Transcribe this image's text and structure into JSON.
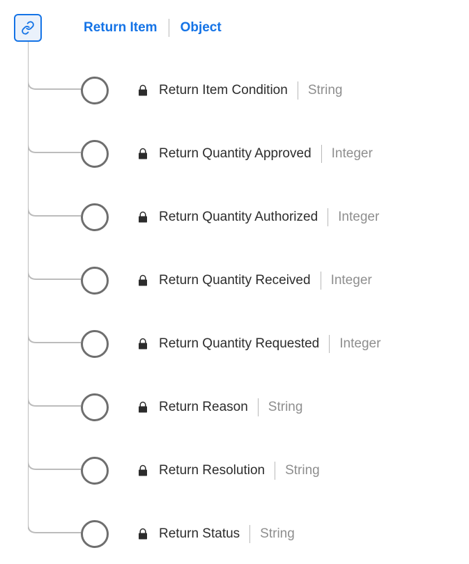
{
  "root": {
    "name": "Return Item",
    "type": "Object"
  },
  "children": [
    {
      "name": "Return Item Condition",
      "type": "String",
      "locked": true
    },
    {
      "name": "Return Quantity Approved",
      "type": "Integer",
      "locked": true
    },
    {
      "name": "Return Quantity Authorized",
      "type": "Integer",
      "locked": true
    },
    {
      "name": "Return Quantity Received",
      "type": "Integer",
      "locked": true
    },
    {
      "name": "Return Quantity Requested",
      "type": "Integer",
      "locked": true
    },
    {
      "name": "Return Reason",
      "type": "String",
      "locked": true
    },
    {
      "name": "Return Resolution",
      "type": "String",
      "locked": true
    },
    {
      "name": "Return Status",
      "type": "String",
      "locked": true
    }
  ]
}
